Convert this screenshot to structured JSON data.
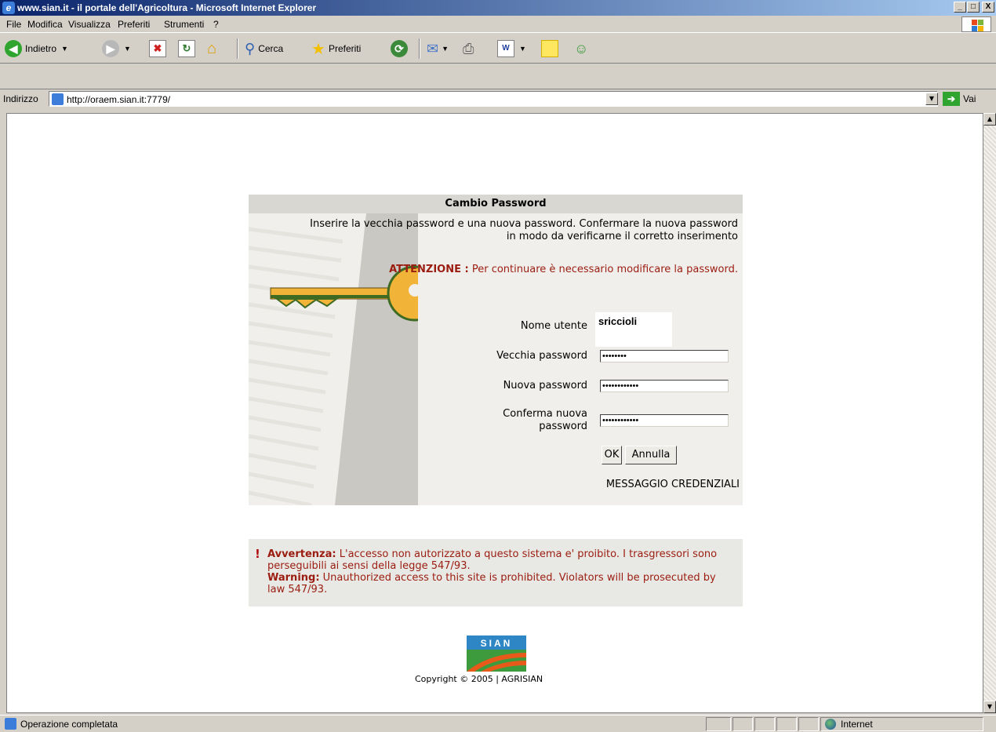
{
  "window": {
    "title": "www.sian.it - il portale dell'Agricoltura - Microsoft Internet Explorer",
    "minimize": "_",
    "maximize": "□",
    "close": "X"
  },
  "menu": {
    "items": [
      "File",
      "Modifica",
      "Visualizza",
      "Preferiti",
      "Strumenti",
      "?"
    ]
  },
  "toolbar": {
    "back_label": "Indietro",
    "search_label": "Cerca",
    "favorites_label": "Preferiti"
  },
  "address": {
    "label": "Indirizzo",
    "url": "http://oraem.sian.it:7779/",
    "go_label": "Vai"
  },
  "panel": {
    "title": "Cambio Password",
    "intro_line1": "Inserire la vecchia password e una nuova password. Confermare la nuova password",
    "intro_line2": "in modo da verificarne il corretto inserimento",
    "attention_label": "ATTENZIONE :",
    "attention_text": "Per continuare è necessario modificare la password.",
    "fields": {
      "username_label": "Nome utente",
      "username_value": "sriccioli",
      "old_password_label": "Vecchia password",
      "old_password_value": "••••••••",
      "new_password_label": "Nuova password",
      "new_password_value": "••••••••••••",
      "confirm_label_line1": "Conferma nuova",
      "confirm_label_line2": "password",
      "confirm_value": "••••••••••••"
    },
    "ok_button": "OK",
    "cancel_button": "Annulla",
    "credentials_message": "MESSAGGIO CREDENZIALI"
  },
  "warning": {
    "it_label": "Avvertenza:",
    "it_text": "L'accesso non autorizzato a questo sistema e' proibito. I trasgressori sono perseguibili ai sensi della legge 547/93.",
    "en_label": "Warning:",
    "en_text": "Unauthorized access to this site is prohibited. Violators will be prosecuted by law 547/93."
  },
  "footer": {
    "logo_text": "SIAN",
    "copyright": "Copyright © 2005 | AGRISIAN"
  },
  "status": {
    "text": "Operazione completata",
    "zone": "Internet"
  },
  "colors": {
    "accent_red": "#9b1c10",
    "panel_bg": "#f0efec",
    "titlebar_start": "#0a246a"
  }
}
